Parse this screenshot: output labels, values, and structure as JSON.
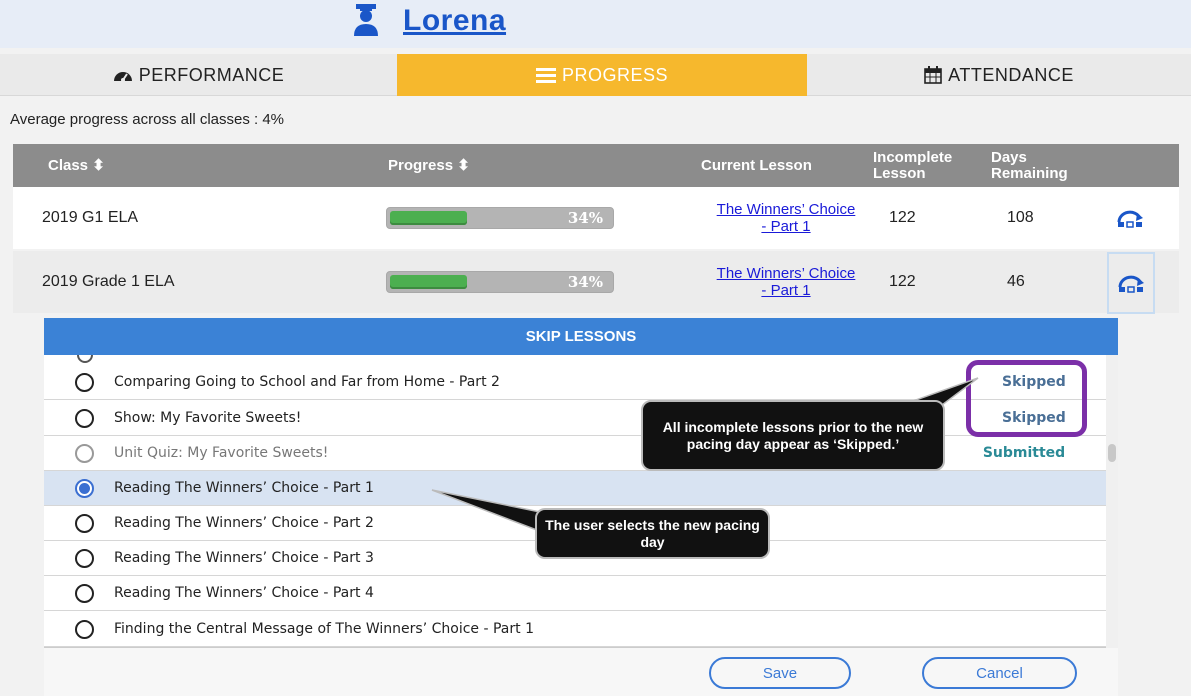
{
  "header": {
    "user_name": "Lorena",
    "user_icon": "student-icon"
  },
  "tabs": [
    {
      "label": "PERFORMANCE",
      "icon": "dashboard-icon"
    },
    {
      "label": "PROGRESS",
      "icon": "list-icon",
      "active": true
    },
    {
      "label": "ATTENDANCE",
      "icon": "calendar-icon"
    }
  ],
  "summary": {
    "text": "Average progress across all classes : 4%"
  },
  "table": {
    "headers": {
      "class": "Class ⬍",
      "progress": "Progress ⬍",
      "current_lesson": "Current Lesson",
      "incomplete": "Incomplete Lesson",
      "days": "Days Remaining"
    },
    "rows": [
      {
        "class": "2019 G1 ELA",
        "progress_pct": 34,
        "progress_label": "34%",
        "current_lesson": "The Winners’ Choice - Part 1",
        "incomplete": "122",
        "days": "108",
        "action_icon": "skip-icon"
      },
      {
        "class": "2019 Grade 1 ELA",
        "progress_pct": 34,
        "progress_label": "34%",
        "current_lesson": "The Winners’ Choice - Part 1",
        "incomplete": "122",
        "days": "46",
        "action_icon": "skip-icon"
      }
    ]
  },
  "modal": {
    "title": "SKIP LESSONS",
    "items": [
      {
        "label": "Comparing Going to School and Far from Home - Part 2",
        "status": "Skipped"
      },
      {
        "label": "Show: My Favorite Sweets!",
        "status": "Skipped"
      },
      {
        "label": "Unit Quiz: My Favorite Sweets!",
        "status": "Submitted",
        "disabled": true
      },
      {
        "label": "Reading The Winners’ Choice - Part 1",
        "status": "",
        "selected": true
      },
      {
        "label": "Reading The Winners’ Choice - Part 2",
        "status": ""
      },
      {
        "label": "Reading The Winners’ Choice - Part 3",
        "status": ""
      },
      {
        "label": "Reading The Winners’ Choice - Part 4",
        "status": ""
      },
      {
        "label": "Finding the Central Message of The Winners’ Choice - Part 1",
        "status": ""
      }
    ],
    "save_label": "Save",
    "cancel_label": "Cancel"
  },
  "callouts": {
    "skipped": "All incomplete lessons prior to the new pacing day appear as ‘Skipped.’",
    "select": "The user selects the new pacing day"
  },
  "colors": {
    "tab_active": "#f6b82d",
    "modal_header": "#3b82d6",
    "highlight": "#7b2fa8",
    "link": "#1a1ad8"
  }
}
